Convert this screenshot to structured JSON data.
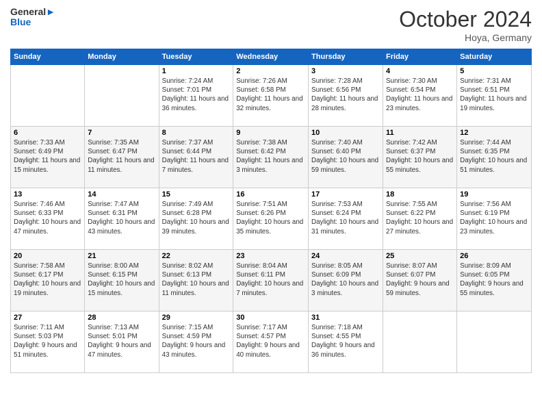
{
  "header": {
    "logo_line1": "General",
    "logo_line2": "Blue",
    "month": "October 2024",
    "location": "Hoya, Germany"
  },
  "days_of_week": [
    "Sunday",
    "Monday",
    "Tuesday",
    "Wednesday",
    "Thursday",
    "Friday",
    "Saturday"
  ],
  "weeks": [
    [
      {
        "day": "",
        "info": ""
      },
      {
        "day": "",
        "info": ""
      },
      {
        "day": "1",
        "info": "Sunrise: 7:24 AM\nSunset: 7:01 PM\nDaylight: 11 hours and 36 minutes."
      },
      {
        "day": "2",
        "info": "Sunrise: 7:26 AM\nSunset: 6:58 PM\nDaylight: 11 hours and 32 minutes."
      },
      {
        "day": "3",
        "info": "Sunrise: 7:28 AM\nSunset: 6:56 PM\nDaylight: 11 hours and 28 minutes."
      },
      {
        "day": "4",
        "info": "Sunrise: 7:30 AM\nSunset: 6:54 PM\nDaylight: 11 hours and 23 minutes."
      },
      {
        "day": "5",
        "info": "Sunrise: 7:31 AM\nSunset: 6:51 PM\nDaylight: 11 hours and 19 minutes."
      }
    ],
    [
      {
        "day": "6",
        "info": "Sunrise: 7:33 AM\nSunset: 6:49 PM\nDaylight: 11 hours and 15 minutes."
      },
      {
        "day": "7",
        "info": "Sunrise: 7:35 AM\nSunset: 6:47 PM\nDaylight: 11 hours and 11 minutes."
      },
      {
        "day": "8",
        "info": "Sunrise: 7:37 AM\nSunset: 6:44 PM\nDaylight: 11 hours and 7 minutes."
      },
      {
        "day": "9",
        "info": "Sunrise: 7:38 AM\nSunset: 6:42 PM\nDaylight: 11 hours and 3 minutes."
      },
      {
        "day": "10",
        "info": "Sunrise: 7:40 AM\nSunset: 6:40 PM\nDaylight: 10 hours and 59 minutes."
      },
      {
        "day": "11",
        "info": "Sunrise: 7:42 AM\nSunset: 6:37 PM\nDaylight: 10 hours and 55 minutes."
      },
      {
        "day": "12",
        "info": "Sunrise: 7:44 AM\nSunset: 6:35 PM\nDaylight: 10 hours and 51 minutes."
      }
    ],
    [
      {
        "day": "13",
        "info": "Sunrise: 7:46 AM\nSunset: 6:33 PM\nDaylight: 10 hours and 47 minutes."
      },
      {
        "day": "14",
        "info": "Sunrise: 7:47 AM\nSunset: 6:31 PM\nDaylight: 10 hours and 43 minutes."
      },
      {
        "day": "15",
        "info": "Sunrise: 7:49 AM\nSunset: 6:28 PM\nDaylight: 10 hours and 39 minutes."
      },
      {
        "day": "16",
        "info": "Sunrise: 7:51 AM\nSunset: 6:26 PM\nDaylight: 10 hours and 35 minutes."
      },
      {
        "day": "17",
        "info": "Sunrise: 7:53 AM\nSunset: 6:24 PM\nDaylight: 10 hours and 31 minutes."
      },
      {
        "day": "18",
        "info": "Sunrise: 7:55 AM\nSunset: 6:22 PM\nDaylight: 10 hours and 27 minutes."
      },
      {
        "day": "19",
        "info": "Sunrise: 7:56 AM\nSunset: 6:19 PM\nDaylight: 10 hours and 23 minutes."
      }
    ],
    [
      {
        "day": "20",
        "info": "Sunrise: 7:58 AM\nSunset: 6:17 PM\nDaylight: 10 hours and 19 minutes."
      },
      {
        "day": "21",
        "info": "Sunrise: 8:00 AM\nSunset: 6:15 PM\nDaylight: 10 hours and 15 minutes."
      },
      {
        "day": "22",
        "info": "Sunrise: 8:02 AM\nSunset: 6:13 PM\nDaylight: 10 hours and 11 minutes."
      },
      {
        "day": "23",
        "info": "Sunrise: 8:04 AM\nSunset: 6:11 PM\nDaylight: 10 hours and 7 minutes."
      },
      {
        "day": "24",
        "info": "Sunrise: 8:05 AM\nSunset: 6:09 PM\nDaylight: 10 hours and 3 minutes."
      },
      {
        "day": "25",
        "info": "Sunrise: 8:07 AM\nSunset: 6:07 PM\nDaylight: 9 hours and 59 minutes."
      },
      {
        "day": "26",
        "info": "Sunrise: 8:09 AM\nSunset: 6:05 PM\nDaylight: 9 hours and 55 minutes."
      }
    ],
    [
      {
        "day": "27",
        "info": "Sunrise: 7:11 AM\nSunset: 5:03 PM\nDaylight: 9 hours and 51 minutes."
      },
      {
        "day": "28",
        "info": "Sunrise: 7:13 AM\nSunset: 5:01 PM\nDaylight: 9 hours and 47 minutes."
      },
      {
        "day": "29",
        "info": "Sunrise: 7:15 AM\nSunset: 4:59 PM\nDaylight: 9 hours and 43 minutes."
      },
      {
        "day": "30",
        "info": "Sunrise: 7:17 AM\nSunset: 4:57 PM\nDaylight: 9 hours and 40 minutes."
      },
      {
        "day": "31",
        "info": "Sunrise: 7:18 AM\nSunset: 4:55 PM\nDaylight: 9 hours and 36 minutes."
      },
      {
        "day": "",
        "info": ""
      },
      {
        "day": "",
        "info": ""
      }
    ]
  ]
}
